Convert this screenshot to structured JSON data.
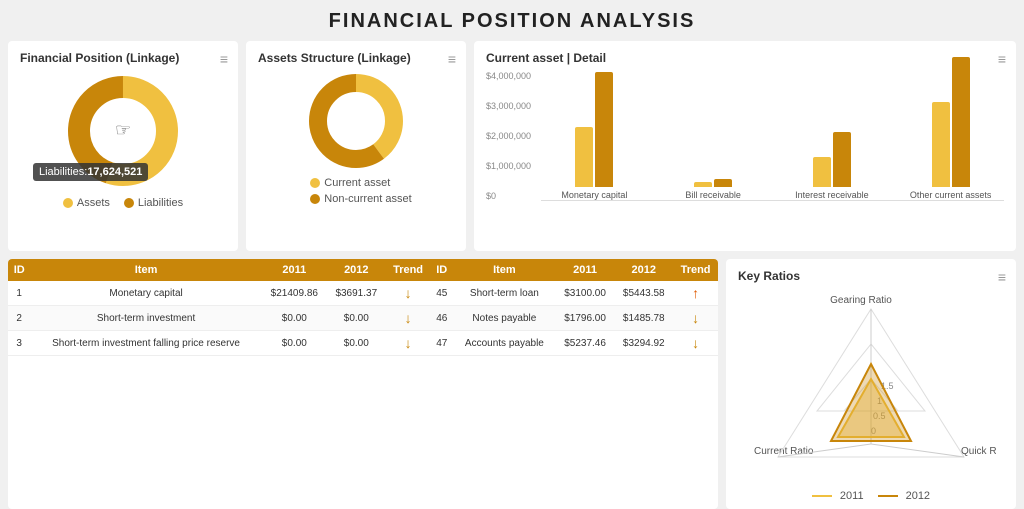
{
  "title": "FINANCIAL POSITION ANALYSIS",
  "cards": {
    "financial_position": {
      "title": "Financial Position (Linkage)",
      "tooltip_label": "Liabilities:",
      "tooltip_value": "17,624,521",
      "legend": [
        {
          "label": "Assets",
          "color": "#f0c040"
        },
        {
          "label": "Liabilities",
          "color": "#c8860a"
        }
      ],
      "donut": {
        "assets_pct": 55,
        "liabilities_pct": 45
      }
    },
    "assets_structure": {
      "title": "Assets Structure (Linkage)",
      "legend": [
        {
          "label": "Current asset",
          "color": "#f0c040"
        },
        {
          "label": "Non-current asset",
          "color": "#c8860a"
        }
      ]
    },
    "current_asset": {
      "title": "Current asset | Detail",
      "y_labels": [
        "$4,000,000",
        "$3,000,000",
        "$2,000,000",
        "$1,000,000",
        "$0"
      ],
      "bars": [
        {
          "label": "Monetary capital",
          "value_2011": 60,
          "value_2012": 115,
          "color_2011": "#f0c040",
          "color_2012": "#c8860a"
        },
        {
          "label": "Bill receivable",
          "value_2011": 5,
          "value_2012": 8,
          "color_2011": "#f0c040",
          "color_2012": "#c8860a"
        },
        {
          "label": "Interest receivable",
          "value_2011": 30,
          "value_2012": 55,
          "color_2011": "#f0c040",
          "color_2012": "#c8860a"
        },
        {
          "label": "Other current assets",
          "value_2011": 85,
          "value_2012": 130,
          "color_2011": "#f0c040",
          "color_2012": "#c8860a"
        }
      ]
    }
  },
  "table": {
    "columns": [
      "ID",
      "Item",
      "2011",
      "2012",
      "Trend",
      "ID",
      "Item",
      "2011",
      "2012",
      "Trend"
    ],
    "rows": [
      {
        "id1": "1",
        "item1": "Monetary capital",
        "y2011_1": "$21409.86",
        "y2012_1": "$3691.37",
        "trend1": "down",
        "id2": "45",
        "item2": "Short-term loan",
        "y2011_2": "$3100.00",
        "y2012_2": "$5443.58",
        "trend2": "up"
      },
      {
        "id1": "2",
        "item1": "Short-term investment",
        "y2011_1": "$0.00",
        "y2012_1": "$0.00",
        "trend1": "down",
        "id2": "46",
        "item2": "Notes payable",
        "y2011_2": "$1796.00",
        "y2012_2": "$1485.78",
        "trend2": "down"
      },
      {
        "id1": "3",
        "item1": "Short-term investment falling price reserve",
        "y2011_1": "$0.00",
        "y2012_1": "$0.00",
        "trend1": "down",
        "id2": "47",
        "item2": "Accounts payable",
        "y2011_2": "$5237.46",
        "y2012_2": "$3294.92",
        "trend2": "down"
      }
    ]
  },
  "key_ratios": {
    "title": "Key Ratios",
    "axes": [
      "Gearing Ratio",
      "Quick Ratio",
      "Current Ratio"
    ],
    "scale_labels": [
      "0",
      "0.5",
      "1",
      "1.5"
    ],
    "legend": [
      {
        "label": "2011",
        "color": "#f0c040"
      },
      {
        "label": "2012",
        "color": "#c8860a"
      }
    ]
  }
}
